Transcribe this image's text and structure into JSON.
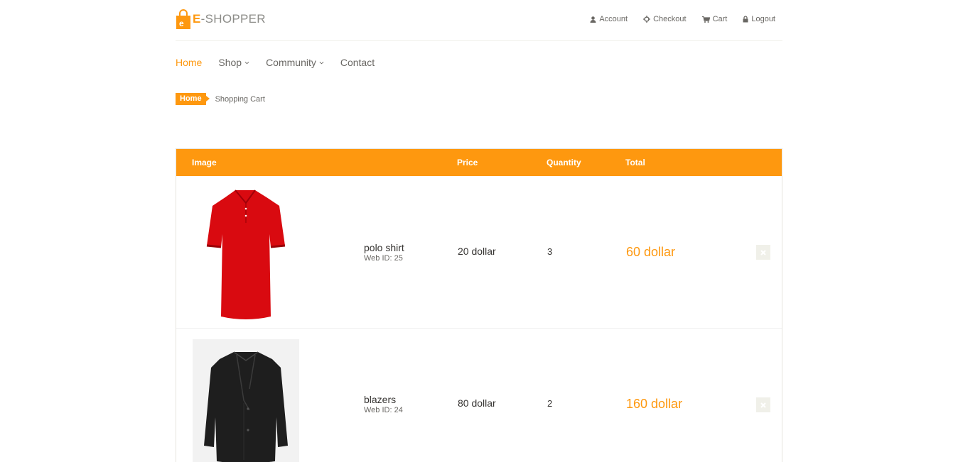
{
  "brand": {
    "text": "E-SHOPPER",
    "accent": "#fe980f"
  },
  "shop_menu": [
    {
      "label": "Account",
      "icon": "user-icon"
    },
    {
      "label": "Checkout",
      "icon": "crosshairs-icon"
    },
    {
      "label": "Cart",
      "icon": "cart-icon"
    },
    {
      "label": "Logout",
      "icon": "lock-icon"
    }
  ],
  "main_menu": [
    {
      "label": "Home",
      "active": true
    },
    {
      "label": "Shop",
      "dropdown": true
    },
    {
      "label": "Community",
      "dropdown": true
    },
    {
      "label": "Contact"
    }
  ],
  "breadcrumb": {
    "home": "Home",
    "current": "Shopping Cart"
  },
  "cart": {
    "headers": {
      "image": "Image",
      "price": "Price",
      "quantity": "Quantity",
      "total": "Total"
    },
    "items": [
      {
        "name": "polo shirt",
        "web_id": "Web ID: 25",
        "price": "20 dollar",
        "quantity": "3",
        "total": "60 dollar",
        "image": "red-polo-shirt",
        "delete_icon": "close-icon"
      },
      {
        "name": "blazers",
        "web_id": "Web ID: 24",
        "price": "80 dollar",
        "quantity": "2",
        "total": "160 dollar",
        "image": "black-blazer",
        "delete_icon": "close-icon"
      }
    ]
  }
}
